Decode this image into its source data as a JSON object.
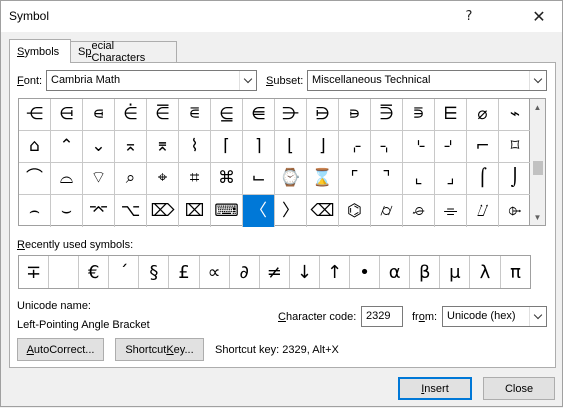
{
  "window": {
    "title": "Symbol",
    "help_glyph": "?",
    "close_glyph": "✕"
  },
  "tabs": [
    {
      "label": "Symbols",
      "mnemonic": "S",
      "rest": "ymbols",
      "active": true
    },
    {
      "label": "Special Characters",
      "pre": "S",
      "mnemonic": "p",
      "rest": "ecial Characters",
      "active": false
    }
  ],
  "font": {
    "label_mn": "F",
    "label_rest": "ont:",
    "value": "Cambria Math"
  },
  "subset": {
    "label_mn": "S",
    "label_rest": "ubset:",
    "value": "Miscellaneous Technical"
  },
  "symbol_grid": {
    "rows": [
      [
        "⋲",
        "⋳",
        "⋴",
        "⋵",
        "⋶",
        "⋷",
        "⋸",
        "⋹",
        "⋺",
        "⋻",
        "⋼",
        "⋽",
        "⋾",
        "⋿",
        "⌀",
        "⌁"
      ],
      [
        "⌂",
        "⌃",
        "⌄",
        "⌅",
        "⌆",
        "⌇",
        "⌈",
        "⌉",
        "⌊",
        "⌋",
        "⌌",
        "⌍",
        "⌎",
        "⌏",
        "⌐",
        "⌑"
      ],
      [
        "⌒",
        "⌓",
        "⌔",
        "⌕",
        "⌖",
        "⌗",
        "⌘",
        "⌙",
        "⌚",
        "⌛",
        "⌜",
        "⌝",
        "⌞",
        "⌟",
        "⌠",
        "⌡"
      ],
      [
        "⌢",
        "⌣",
        "⌤",
        "⌥",
        "⌦",
        "⌧",
        "⌨",
        "〈",
        "〉",
        "⌫",
        "⌬",
        "⌭",
        "⌮",
        "⌯",
        "⌰",
        "⌱"
      ]
    ],
    "selected_row": 3,
    "selected_col": 7
  },
  "recent": {
    "label": "Recently used symbols:",
    "label_mn": "R",
    "label_rest": "ecently used symbols:",
    "symbols": [
      "∓",
      " ",
      "€",
      "´",
      "§",
      "£",
      "∝",
      "∂",
      "≠",
      "↓",
      "↑",
      "•",
      "α",
      "β",
      "μ",
      "λ",
      "π"
    ]
  },
  "unicode": {
    "name_label": "Unicode name:",
    "name_value": "Left-Pointing Angle Bracket"
  },
  "char_code": {
    "label_pre": "",
    "label_mn": "C",
    "label_rest": "haracter code:",
    "value": "2329"
  },
  "from": {
    "label_pre": "fr",
    "label_mn": "o",
    "label_rest": "m:",
    "value": "Unicode (hex)"
  },
  "buttons": {
    "autocorrect_mn": "A",
    "autocorrect_rest": "utoCorrect...",
    "shortcut_pre": "Shortcut ",
    "shortcut_mn": "K",
    "shortcut_rest": "ey...",
    "insert_mn": "I",
    "insert_rest": "nsert",
    "close": "Close"
  },
  "shortcut_info": "Shortcut key: 2329, Alt+X"
}
